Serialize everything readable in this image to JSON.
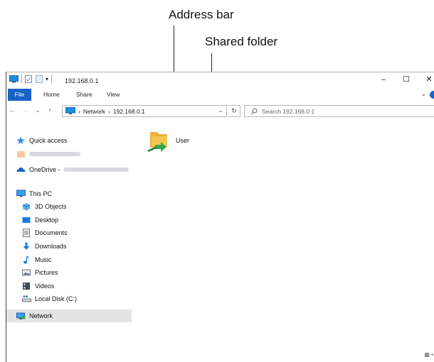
{
  "annotations": {
    "address_bar": "Address bar",
    "shared_folder": "Shared folder"
  },
  "window": {
    "title": "192.168.0.1",
    "controls": {
      "minimize": "–",
      "maximize": "☐",
      "close": "✕"
    }
  },
  "ribbon": {
    "tabs": [
      "File",
      "Home",
      "Share",
      "View"
    ],
    "expand": "⌄"
  },
  "nav": {
    "back": "←",
    "forward": "→",
    "recent": "⌄",
    "up": "↑",
    "breadcrumb": [
      "Network",
      "192.168.0.1"
    ],
    "crumb_sep": "›",
    "dropdown": "⌄",
    "refresh": "↻",
    "search_placeholder": "Search 192.168.0.1"
  },
  "sidebar": {
    "items": [
      {
        "label": "Quick access",
        "icon": "star-icon"
      },
      {
        "label": "",
        "icon": "creative-cloud-icon"
      },
      {
        "label": "OneDrive -",
        "icon": "cloud-icon"
      },
      {
        "label": "This PC",
        "icon": "monitor-icon"
      },
      {
        "label": "3D Objects",
        "icon": "cube-icon"
      },
      {
        "label": "Desktop",
        "icon": "desktop-icon"
      },
      {
        "label": "Documents",
        "icon": "document-icon"
      },
      {
        "label": "Downloads",
        "icon": "download-icon"
      },
      {
        "label": "Music",
        "icon": "music-icon"
      },
      {
        "label": "Pictures",
        "icon": "pictures-icon"
      },
      {
        "label": "Videos",
        "icon": "video-icon"
      },
      {
        "label": "Local Disk (C:)",
        "icon": "disk-icon"
      },
      {
        "label": "Network",
        "icon": "network-icon"
      }
    ]
  },
  "content": {
    "items": [
      {
        "label": "User",
        "icon": "shared-folder-icon"
      }
    ]
  },
  "colors": {
    "accent": "#1a62c6",
    "folder": "#f4c553",
    "share_arrow": "#3aa64a",
    "selected": "#e3e3e3"
  }
}
